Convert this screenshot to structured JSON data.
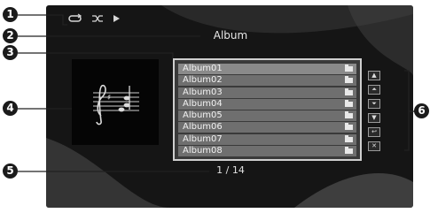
{
  "title": "Album",
  "list_items": [
    "Album01",
    "Album02",
    "Album03",
    "Album04",
    "Album05",
    "Album06",
    "Album07",
    "Album08"
  ],
  "selected_index": 0,
  "page_indicator": "1 / 14",
  "status_icons": [
    "repeat-icon",
    "shuffle-icon",
    "play-icon"
  ],
  "operation_icons": [
    "up-icon",
    "page-up-icon",
    "page-down-icon",
    "down-icon",
    "return-icon",
    "search-icon"
  ],
  "callouts": [
    "1",
    "2",
    "3",
    "4",
    "5",
    "6"
  ],
  "colors": {
    "screen_bg": "#151515",
    "row_bg": "#6f6f6f",
    "text": "#f2f2f2"
  }
}
